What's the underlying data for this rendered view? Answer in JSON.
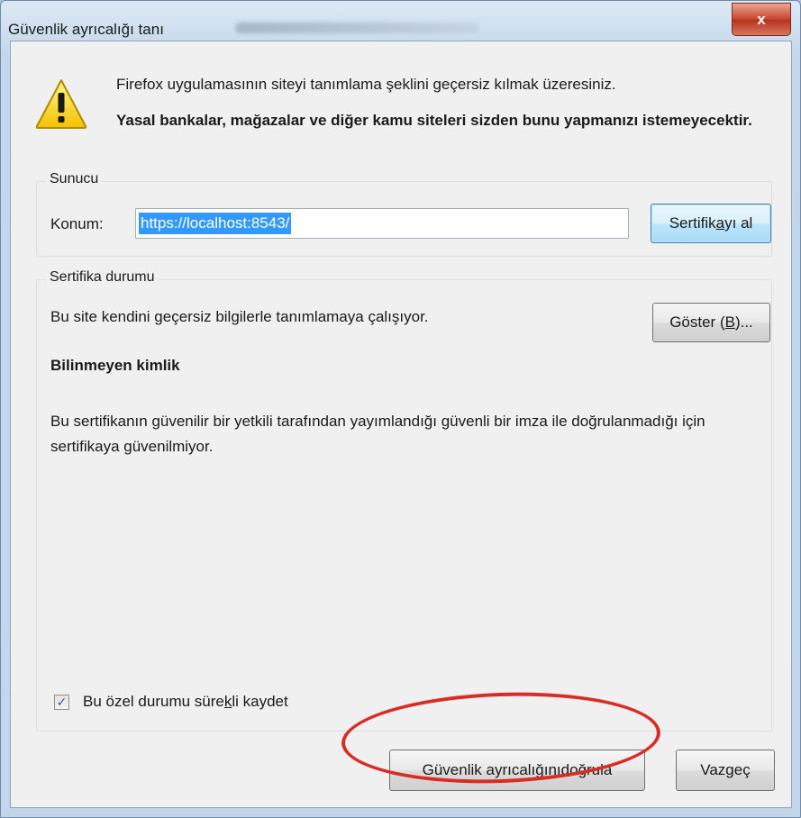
{
  "window": {
    "title": "Güvenlik ayrıcalığı tanı",
    "close_label": "x"
  },
  "warning": {
    "line1": "Firefox uygulamasının siteyi tanımlama şeklini geçersiz kılmak üzeresiniz.",
    "line2": "Yasal bankalar, mağazalar ve diğer kamu siteleri sizden bunu yapmanızı istemeyecektir."
  },
  "server_group": {
    "label": "Sunucu",
    "location_label": "Konum:",
    "location_value": "https://localhost:8543/",
    "get_cert_button": {
      "pre": "Sertifik",
      "accel": "a",
      "post": "yı al"
    }
  },
  "cert_group": {
    "label": "Sertifika durumu",
    "status_text": "Bu site kendini geçersiz bilgilerle tanımlamaya çalışıyor.",
    "show_button": {
      "pre": "Göster (",
      "accel": "B",
      "post": ")..."
    },
    "heading": "Bilinmeyen kimlik",
    "description": "Bu sertifikanın güvenilir bir yetkili tarafından yayımlandığı güvenli bir imza ile doğrulanmadığı için sertifikaya güvenilmiyor."
  },
  "permanent_checkbox": {
    "checked": true,
    "label_pre": "Bu özel durumu süre",
    "label_accel": "k",
    "label_post": "li kaydet"
  },
  "buttons": {
    "confirm": {
      "pre": "Güvenlik ayrıcalığını ",
      "accel": "d",
      "post": "oğrula"
    },
    "cancel": "Vazgeç"
  },
  "colors": {
    "annotation_ellipse": "#d92c24",
    "selection": "#3399ff"
  }
}
